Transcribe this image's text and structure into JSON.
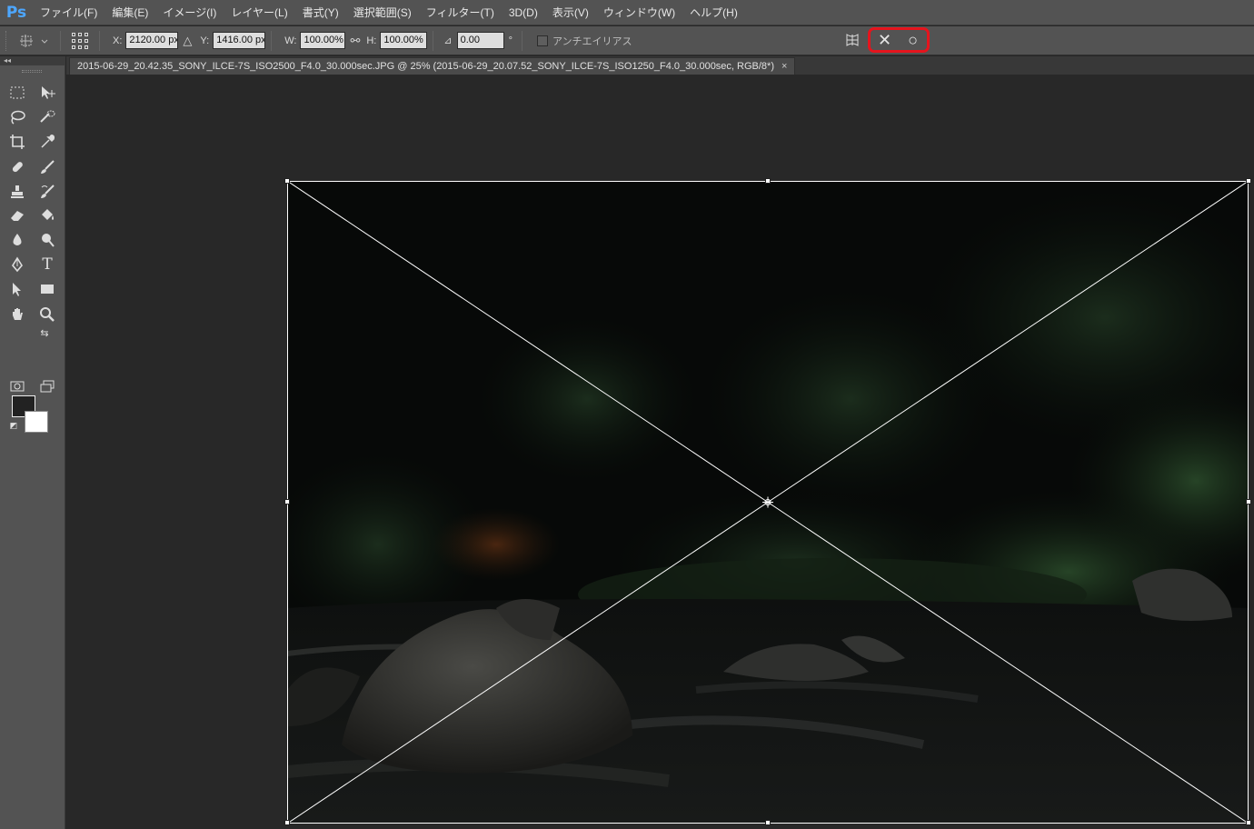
{
  "app": {
    "logo": "Ps"
  },
  "menu": [
    "ファイル(F)",
    "編集(E)",
    "イメージ(I)",
    "レイヤー(L)",
    "書式(Y)",
    "選択範囲(S)",
    "フィルター(T)",
    "3D(D)",
    "表示(V)",
    "ウィンドウ(W)",
    "ヘルプ(H)"
  ],
  "options": {
    "x_label": "X:",
    "x_value": "2120.00 px",
    "y_label": "Y:",
    "y_value": "1416.00 px",
    "w_label": "W:",
    "w_value": "100.00%",
    "h_label": "H:",
    "h_value": "100.00%",
    "angle_value": "0.00",
    "angle_unit": "°",
    "antialias_label": "アンチエイリアス",
    "antialias_checked": false
  },
  "document": {
    "tab_title": "2015-06-29_20.42.35_SONY_ILCE-7S_ISO2500_F4.0_30.000sec.JPG @ 25% (2015-06-29_20.07.52_SONY_ILCE-7S_ISO1250_F4.0_30.000sec, RGB/8*)",
    "close_glyph": "×"
  },
  "tools": {
    "text_tool_glyph": "T",
    "foreground_color": "#222222",
    "background_color": "#ffffff"
  },
  "colors": {
    "highlight": "#e5141d",
    "logo": "#4da7ff"
  }
}
